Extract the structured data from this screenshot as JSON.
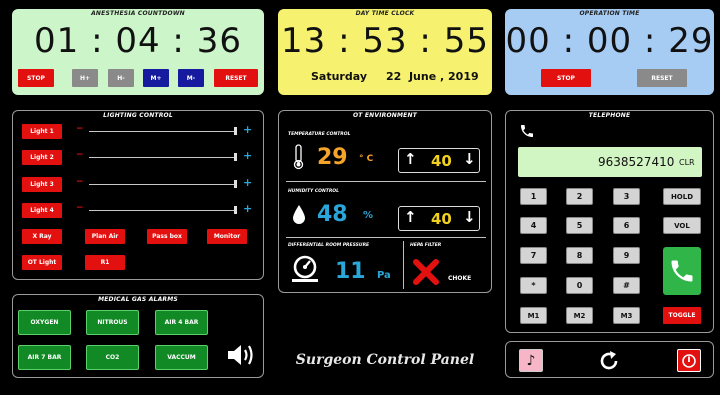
{
  "anesthesia": {
    "title": "ANESTHESIA COUNTDOWN",
    "time": "01 : 04 : 36",
    "buttons": {
      "stop": "STOP",
      "h_plus": "H+",
      "h_minus": "H-",
      "m_plus": "M+",
      "m_minus": "M-",
      "reset": "RESET"
    },
    "bg": "#ccf5c9"
  },
  "daytime": {
    "title": "DAY TIME CLOCK",
    "time": "13 : 53 : 55",
    "weekday": "Saturday",
    "date": "22  June , 2019",
    "bg": "#f6f26f"
  },
  "operation": {
    "title": "OPERATION TIME",
    "time": "00 : 00 : 29",
    "buttons": {
      "stop": "STOP",
      "reset": "RESET"
    },
    "bg": "#a7ccf3"
  },
  "lighting": {
    "title": "LIGHTING CONTROL",
    "lights": [
      {
        "label": "Light 1",
        "level": 1.0
      },
      {
        "label": "Light 2",
        "level": 1.0
      },
      {
        "label": "Light 3",
        "level": 1.0
      },
      {
        "label": "Light 4",
        "level": 1.0
      }
    ],
    "buttons": [
      "X Ray",
      "Plan Air",
      "Pass box",
      "Monitor",
      "OT Light",
      "R1"
    ]
  },
  "environment": {
    "title": "OT ENVIRONMENT",
    "temperature": {
      "label": "TEMPERATURE CONTROL",
      "value": "29",
      "unit": "° C",
      "set": "40"
    },
    "humidity": {
      "label": "HUMIDITY CONTROL",
      "value": "48",
      "unit": "%",
      "set": "40"
    },
    "pressure": {
      "label": "DIFFERENTIAL ROOM PRESSURE",
      "value": "11",
      "unit": "Pa"
    },
    "hepa": {
      "label": "HEPA FILTER",
      "status": "CHOKE"
    }
  },
  "telephone": {
    "title": "TELEPHONE",
    "number": "9638527410",
    "clear": "CLR",
    "keys": [
      "1",
      "2",
      "3",
      "HOLD",
      "4",
      "5",
      "6",
      "VOL",
      "7",
      "8",
      "9",
      "*",
      "0",
      "#",
      "M1",
      "M2",
      "M3"
    ],
    "toggle": "TOGGLE"
  },
  "gas": {
    "title": "MEDICAL GAS ALARMS",
    "items": [
      "OXYGEN",
      "NITROUS",
      "AIR 4 BAR",
      "AIR 7 BAR",
      "CO2",
      "VACCUM"
    ]
  },
  "footer": {
    "title": "Surgeon Control Panel"
  },
  "icons": {
    "phone": "phone-icon",
    "speaker": "speaker-icon",
    "music": "music-icon",
    "refresh": "refresh-icon",
    "power": "power-icon",
    "thermometer": "thermometer-icon",
    "droplet": "droplet-icon",
    "gauge": "gauge-icon",
    "cross": "cross-icon"
  },
  "colors": {
    "red": "#e31010",
    "blue_value": "#2aa6d8",
    "orange_value": "#f5a42a",
    "set_value": "#f0d020",
    "call_green": "#2fb548",
    "pink": "#f7b6c8"
  }
}
